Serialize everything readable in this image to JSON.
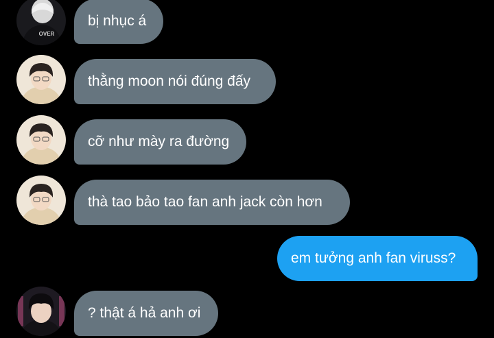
{
  "colors": {
    "background": "#000000",
    "incoming_bubble": "#66757f",
    "outgoing_bubble": "#1da1f2",
    "bubble_text": "#ffffff"
  },
  "messages": [
    {
      "direction": "incoming",
      "avatar": "avatar-dark-hoodie",
      "text": "bị nhục á"
    },
    {
      "direction": "incoming",
      "avatar": "avatar-boy-beige",
      "text": "thằng moon nói đúng đấy"
    },
    {
      "direction": "incoming",
      "avatar": "avatar-boy-beige",
      "text": "cỡ như mày ra đường"
    },
    {
      "direction": "incoming",
      "avatar": "avatar-boy-beige",
      "text": "thà tao bảo tao fan anh jack còn hơn"
    },
    {
      "direction": "outgoing",
      "text": "em tưởng anh fan viruss?"
    },
    {
      "direction": "incoming",
      "avatar": "avatar-boy-dark",
      "text": "? thật á hả anh ơi"
    }
  ],
  "avatar_shirt_text": "OVER"
}
